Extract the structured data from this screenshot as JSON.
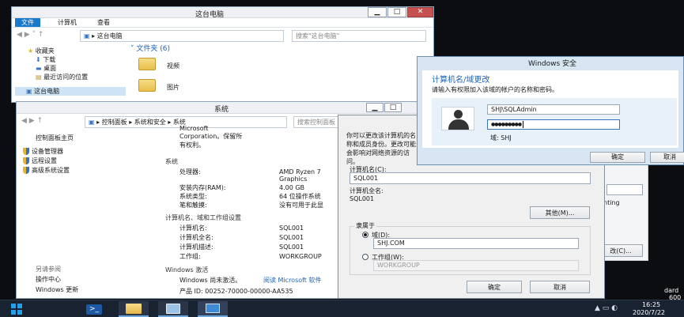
{
  "explorer": {
    "title": "这台电脑",
    "ribbon_tabs": [
      "文件",
      "计算机",
      "查看"
    ],
    "address": "这台电脑",
    "search_placeholder": "搜索\"这台电脑\"",
    "nav": {
      "favorites": "收藏夹",
      "downloads": "下载",
      "desktop": "桌面",
      "recent": "最近访问的位置",
      "this_pc": "这台电脑"
    },
    "folders_header": "文件夹 (6)",
    "folders": [
      "视频",
      "图片"
    ]
  },
  "system": {
    "title": "系统",
    "breadcrumb": [
      "控制面板",
      "系统和安全",
      "系统"
    ],
    "search_placeholder": "搜索控制面板",
    "sidebar": {
      "home": "控制面板主页",
      "links": [
        "设备管理器",
        "远程设置",
        "高级系统设置"
      ],
      "see_also": "另请参阅",
      "see_also_links": [
        "操作中心",
        "Windows 更新"
      ]
    },
    "top_lines": [
      "Microsoft",
      "Corporation。保留所",
      "有权利。"
    ],
    "section_system": "系统",
    "system_rows": [
      {
        "label": "处理器:",
        "value": "AMD Ryzen 7"
      },
      {
        "label": "",
        "value": "Graphics"
      },
      {
        "label": "安装内存(RAM):",
        "value": "4.00 GB"
      },
      {
        "label": "系统类型:",
        "value": "64 位操作系统"
      },
      {
        "label": "笔和触摸:",
        "value": "没有可用于此显"
      }
    ],
    "section_computer": "计算机名、域和工作组设置",
    "computer_rows": [
      {
        "label": "计算机名:",
        "value": "SQL001"
      },
      {
        "label": "计算机全名:",
        "value": "SQL001"
      },
      {
        "label": "计算机描述:",
        "value": "SQL001"
      },
      {
        "label": "工作组:",
        "value": "WORKGROUP"
      }
    ],
    "section_activation": "Windows 激活",
    "activation_text": "Windows 尚未激活。",
    "activation_link": "阅读 Microsoft 软件",
    "product_id": "产品 ID: 00252-70000-00000-AA535"
  },
  "rename": {
    "intro": "你可以更改该计算机的名称和成员身份。更改可能会影响对网络资源的访问。",
    "computer_name_label": "计算机名(C):",
    "computer_name_value": "SQL001",
    "full_name_label": "计算机全名:",
    "full_name_value": "SQL001",
    "other_button": "其他(M)...",
    "member_of": "隶属于",
    "domain_label": "域(D):",
    "domain_value": "SHJ.COM",
    "workgroup_label": "工作组(W):",
    "workgroup_value": "WORKGROUP",
    "ok": "确定",
    "cancel": "取消"
  },
  "behind": {
    "partial_text": "nting",
    "change_button": "改(C)...",
    "corner_lines": [
      "dard",
      "600"
    ]
  },
  "security": {
    "title": "Windows 安全",
    "heading": "计算机名/域更改",
    "subtitle": "请输入有权限加入该域的帐户的名称和密码。",
    "username": "SHJ\\SQLAdmin",
    "password_dots": "●●●●●●●●●",
    "domain_line": "域: SHJ",
    "ok": "确定",
    "cancel": "取消"
  },
  "taskbar": {
    "time": "16:25",
    "date": "2020/7/22"
  }
}
